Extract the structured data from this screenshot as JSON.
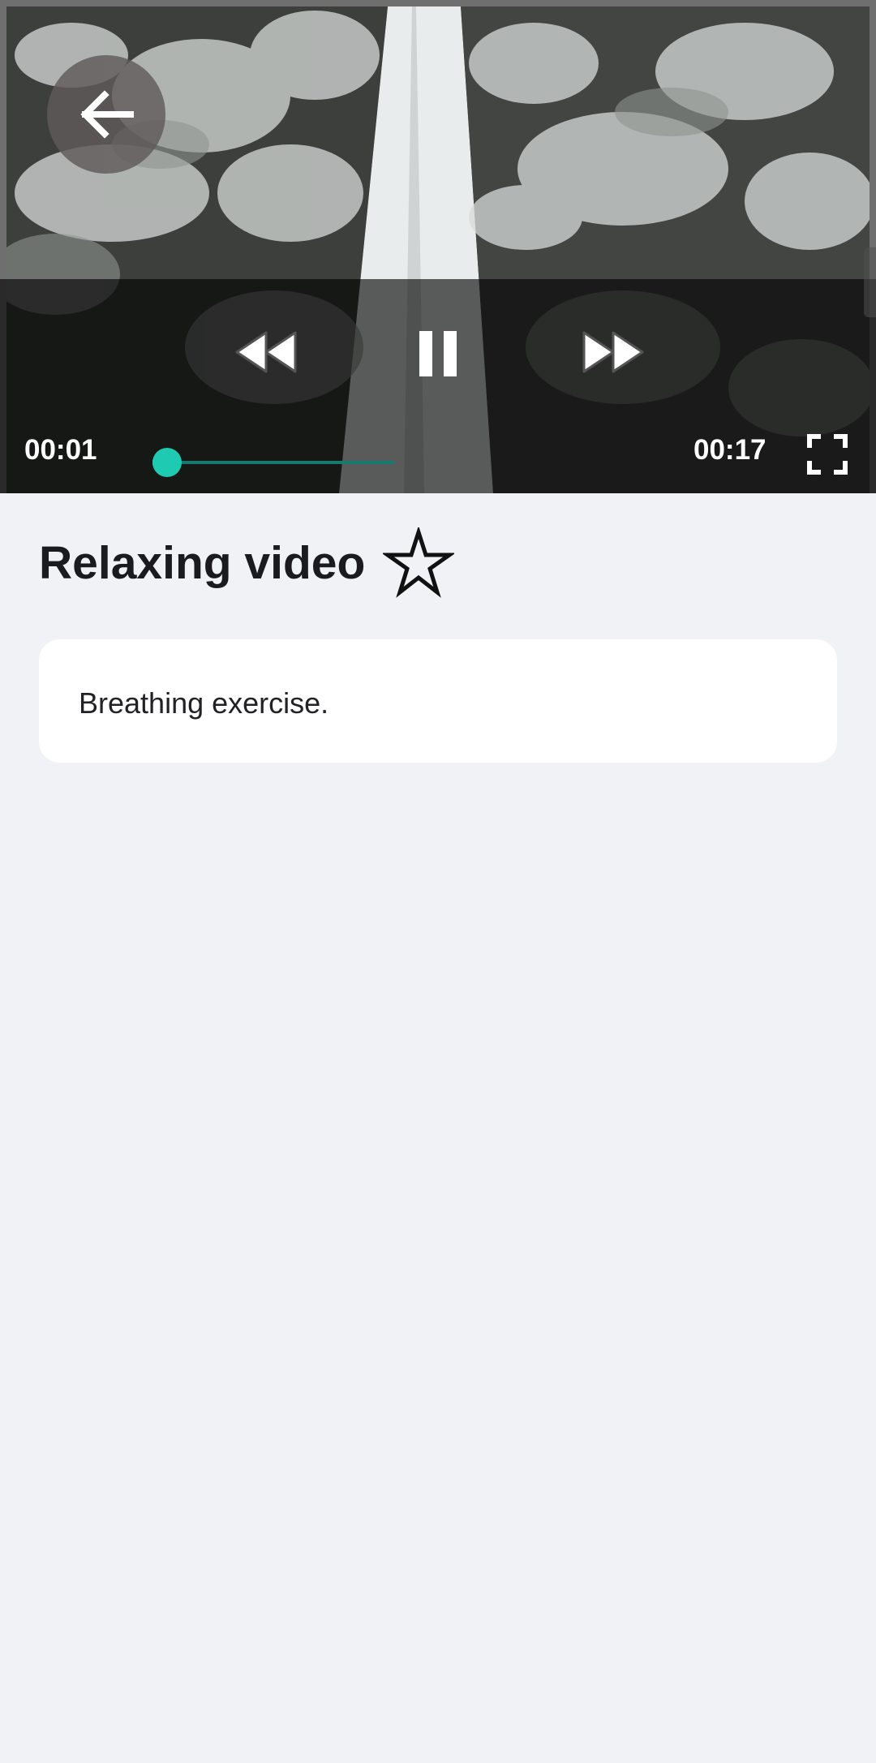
{
  "player": {
    "current_time": "00:01",
    "total_time": "00:17",
    "progress": 0.06,
    "accent_color": "#1ecbb2"
  },
  "icons": {
    "back": "arrow-left-icon",
    "rewind": "rewind-icon",
    "pause": "pause-icon",
    "forward": "fast-forward-icon",
    "fullscreen": "fullscreen-icon",
    "favorite": "star-outline-icon"
  },
  "content": {
    "title": "Relaxing video",
    "description": "Breathing exercise."
  }
}
